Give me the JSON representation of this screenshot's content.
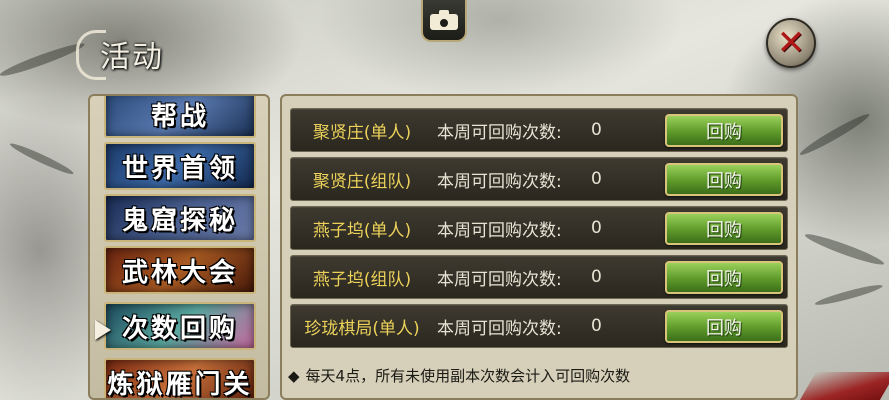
{
  "window": {
    "title": "活动"
  },
  "icons": {
    "camera": "camera-icon",
    "close": "close-icon",
    "selected": "triangle-right-icon"
  },
  "colors": {
    "activity_name": "#ecd25a",
    "button_green": "#5e9a2a",
    "row_bg": "#2a271f"
  },
  "sidebar": {
    "selected_index": 4,
    "items": [
      {
        "label": "帮战"
      },
      {
        "label": "世界首领"
      },
      {
        "label": "鬼窟探秘"
      },
      {
        "label": "武林大会"
      },
      {
        "label": "次数回购"
      },
      {
        "label": "炼狱雁门关"
      }
    ]
  },
  "repurchase": {
    "rows": [
      {
        "name": "聚贤庄(单人)",
        "count_label": "本周可回购次数:",
        "count": "0",
        "button": "回购"
      },
      {
        "name": "聚贤庄(组队)",
        "count_label": "本周可回购次数:",
        "count": "0",
        "button": "回购"
      },
      {
        "name": "燕子坞(单人)",
        "count_label": "本周可回购次数:",
        "count": "0",
        "button": "回购"
      },
      {
        "name": "燕子坞(组队)",
        "count_label": "本周可回购次数:",
        "count": "0",
        "button": "回购"
      },
      {
        "name": "珍珑棋局(单人)",
        "count_label": "本周可回购次数:",
        "count": "0",
        "button": "回购"
      }
    ],
    "note_bullet": "◆",
    "note": "每天4点，所有未使用副本次数会计入可回购次数"
  }
}
